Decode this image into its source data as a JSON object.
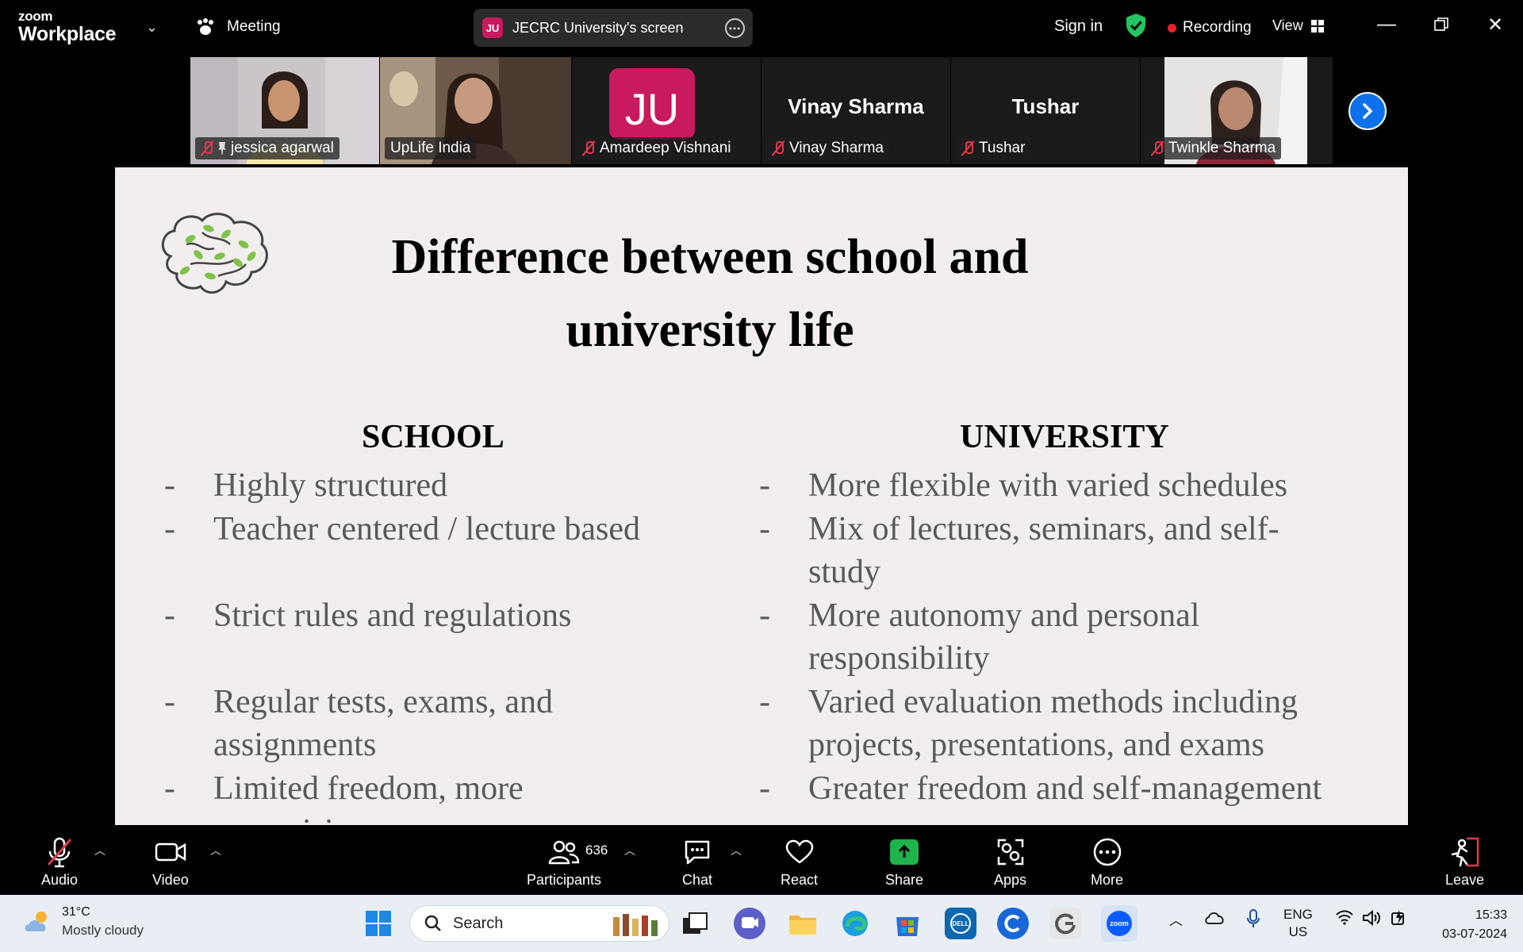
{
  "app": {
    "brand_top": "zoom",
    "brand_bottom": "Workplace",
    "meeting_label": "Meeting"
  },
  "share_pill": {
    "badge": "JU",
    "label": "JECRC University's screen"
  },
  "header": {
    "sign_in": "Sign in",
    "recording": "Recording",
    "view": "View"
  },
  "participants_strip": [
    {
      "name": "jessica agarwal",
      "muted": true,
      "pinned": true,
      "type": "video"
    },
    {
      "name": "UpLife India",
      "muted": false,
      "active_speaker": true,
      "type": "video"
    },
    {
      "name": "Amardeep Vishnani",
      "muted": true,
      "type": "avatar",
      "avatar_text": "JU"
    },
    {
      "name": "Vinay Sharma",
      "muted": true,
      "type": "name",
      "display": "Vinay Sharma"
    },
    {
      "name": "Tushar",
      "muted": true,
      "type": "name",
      "display": "Tushar"
    },
    {
      "name": "Twinkle Sharma",
      "muted": true,
      "type": "video"
    }
  ],
  "slide": {
    "title": "Difference between school and university life",
    "school_heading": "SCHOOL",
    "university_heading": "UNIVERSITY",
    "school_items": [
      "Highly structured",
      "Teacher centered / lecture based",
      "Strict rules and regulations",
      "Regular tests, exams, and assignments",
      "Limited freedom, more supervision"
    ],
    "university_items": [
      "More flexible with varied schedules",
      "Mix of lectures, seminars, and self-study",
      "More autonomy and personal responsibility",
      "Varied evaluation methods including projects, presentations, and exams",
      "Greater freedom and self-management"
    ]
  },
  "toolbar": {
    "audio": "Audio",
    "video": "Video",
    "participants": "Participants",
    "participant_count": "636",
    "chat": "Chat",
    "react": "React",
    "share": "Share",
    "apps": "Apps",
    "more": "More",
    "leave": "Leave"
  },
  "taskbar": {
    "temperature": "31°C",
    "weather": "Mostly cloudy",
    "search_placeholder": "Search",
    "language_top": "ENG",
    "language_bottom": "US",
    "time": "15:33",
    "date": "03-07-2024"
  },
  "colors": {
    "accent_blue": "#0e71eb",
    "ju_pink": "#c9195f",
    "active_green": "#2fd17b",
    "recording_red": "#e8232a",
    "share_green": "#1eb34b"
  }
}
